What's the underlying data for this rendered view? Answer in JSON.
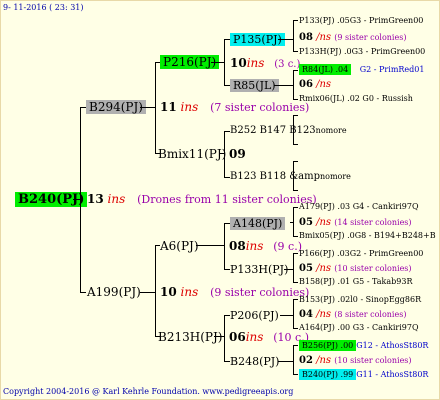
{
  "header": "9- 11-2016 ( 23: 31)",
  "footer": "Copyright 2004-2016 @ Karl Kehrle Foundation.   www.pedigreeapis.org",
  "root": {
    "label": "B240(PJ)",
    "num": "13",
    "ins": "ins",
    "note": "(Drones from 11 sister colonies)"
  },
  "gen1": [
    {
      "label": "B294(PJ)",
      "num": "11",
      "ins": "ins",
      "note": "(7 sister colonies)"
    },
    {
      "label": "A199(PJ)",
      "num": "10",
      "ins": "ins",
      "note": "(9 sister colonies)"
    }
  ],
  "gen2": [
    {
      "label": "P216(PJ)"
    },
    {
      "label": "Bmix11(PJ)",
      "num": "09"
    },
    {
      "label": "A6(PJ)",
      "num": "08",
      "ins": "ins",
      "note": "(9 c.)"
    },
    {
      "label": "B213H(PJ)",
      "num": "06",
      "ins": "ins",
      "note": "(10 c.)"
    }
  ],
  "gen3": [
    {
      "label": "P135(PJ)",
      "num": "10",
      "ins": "ins",
      "note": "(3 c.)"
    },
    {
      "label": "R85(JL)"
    },
    {
      "label": "B252 B147 B123",
      "tail": "nomore"
    },
    {
      "label": "B123 B118 &amp",
      "tail": "nomore"
    },
    {
      "label": "A148(PJ)"
    },
    {
      "label": "P133H(PJ)"
    },
    {
      "label": "P206(PJ)"
    },
    {
      "label": "B248(PJ)"
    }
  ],
  "gen4": [
    {
      "line": "P133(PJ) .05G3 - PrimGreen00"
    },
    {
      "num": "08",
      "ins": "/ns",
      "note": "(9 sister colonies)"
    },
    {
      "line": "P133H(PJ) .0G3 - PrimGreen00"
    },
    {
      "label": "R84(JL) .04",
      "rest": "G2 - PrimRed01"
    },
    {
      "num": "06",
      "ins": "/ns"
    },
    {
      "line": "Rmix06(JL) .02      G0 - Russish"
    },
    {
      "line": "A179(PJ) .03    G4 - Cankiri97Q"
    },
    {
      "num": "05",
      "ins": "/ns",
      "note": "(14 sister colonies)"
    },
    {
      "line": "Bmix05(PJ) .0G8 - B194+B248+B"
    },
    {
      "line": "P166(PJ) .03G2 - PrimGreen00"
    },
    {
      "num": "05",
      "ins": "/ns",
      "note": "(10 sister colonies)"
    },
    {
      "line": "B158(PJ) .01     G5 - Takab93R"
    },
    {
      "line": "B153(PJ) .02l0 - SinopEgg86R"
    },
    {
      "num": "04",
      "ins": "/ns",
      "note": "(8 sister colonies)"
    },
    {
      "line": "A164(PJ) .00    G3 - Cankiri97Q"
    },
    {
      "label": "B256(PJ) .00",
      "rest": "G12 - AthosSt80R"
    },
    {
      "num": "02",
      "ins": "/ns",
      "note": "(10 sister colonies)"
    },
    {
      "label": "B240(PJ) .99",
      "rest": "G11 - AthosSt80R"
    }
  ]
}
